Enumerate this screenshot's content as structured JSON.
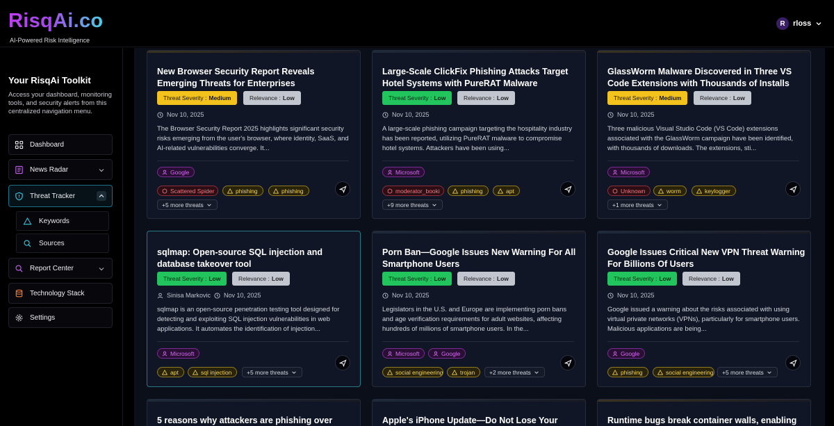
{
  "app": {
    "logo": "RisqAi.co",
    "tagline": "AI-Powered Risk Intelligence",
    "user": {
      "initial": "R",
      "name": "rloss"
    }
  },
  "sidebar": {
    "title": "Your RisqAi Toolkit",
    "description": "Access your dashboard, monitoring tools, and security alerts from this centralized navigation menu.",
    "items": [
      {
        "label": "Dashboard",
        "icon": "grid-icon"
      },
      {
        "label": "News Radar",
        "icon": "newspaper-icon"
      },
      {
        "label": "Threat Tracker",
        "icon": "shield-icon"
      },
      {
        "label": "Report Center",
        "icon": "search-icon"
      },
      {
        "label": "Technology Stack",
        "icon": "database-icon"
      },
      {
        "label": "Settings",
        "icon": "gear-icon"
      }
    ],
    "subitems": [
      {
        "label": "Keywords",
        "icon": "triangle-icon"
      },
      {
        "label": "Sources",
        "icon": "search-icon"
      }
    ]
  },
  "cards": [
    {
      "title": "New Browser Security Report Reveals Emerging Threats for Enterprises",
      "severity_label": "Threat Severity :",
      "severity": "Medium",
      "relevance_label": "Relevance :",
      "relevance": "Low",
      "author": "",
      "date": "Nov 10, 2025",
      "summary": "The Browser Security Report 2025 highlights significant security risks emerging from the user's browser, where identity, SaaS, and AI-related vulnerabilities converge. It...",
      "companies": [
        "Google"
      ],
      "actors": [
        "Scattered Spider"
      ],
      "threats": [
        "phishing",
        "phishing"
      ],
      "more": "+5 more threats"
    },
    {
      "title": "Large-Scale ClickFix Phishing Attacks Target Hotel Systems with PureRAT Malware",
      "severity_label": "Threat Severity :",
      "severity": "Low",
      "relevance_label": "Relevance :",
      "relevance": "Low",
      "author": "",
      "date": "Nov 10, 2025",
      "summary": "A large-scale phishing campaign targeting the hospitality industry has been reported, utilizing PureRAT malware to compromise hotel systems. Attackers have been using...",
      "companies": [
        "Microsoft"
      ],
      "actors": [
        "moderator_booki"
      ],
      "threats": [
        "phishing",
        "apt"
      ],
      "more": "+9 more threats"
    },
    {
      "title": "GlassWorm Malware Discovered in Three VS Code Extensions with Thousands of Installs",
      "severity_label": "Threat Severity :",
      "severity": "Medium",
      "relevance_label": "Relevance :",
      "relevance": "Low",
      "author": "",
      "date": "Nov 10, 2025",
      "summary": "Three malicious Visual Studio Code (VS Code) extensions associated with the GlassWorm campaign have been identified, with thousands of downloads. The extensions, sti...",
      "companies": [
        "Microsoft"
      ],
      "actors": [
        "Unknown"
      ],
      "threats": [
        "worm",
        "keylogger"
      ],
      "more": "+1 more threats"
    },
    {
      "title": "sqlmap: Open-source SQL injection and database takeover tool",
      "severity_label": "Threat Severity :",
      "severity": "Low",
      "relevance_label": "Relevance :",
      "relevance": "Low",
      "author": "Sinisa Markovic",
      "date": "Nov 10, 2025",
      "summary": "sqlmap is an open-source penetration testing tool designed for detecting and exploiting SQL injection vulnerabilities in web applications. It automates the identification of injection...",
      "companies": [
        "Microsoft"
      ],
      "actors": [],
      "threats": [
        "apt",
        "sql injection"
      ],
      "more": "+5 more threats"
    },
    {
      "title": "Porn Ban—Google Issues New Warning For All Smartphone Users",
      "severity_label": "Threat Severity :",
      "severity": "Low",
      "relevance_label": "Relevance :",
      "relevance": "Low",
      "author": "",
      "date": "Nov 10, 2025",
      "summary": "Legislators in the U.S. and Europe are implementing porn bans and age verification requirements for adult websites, affecting hundreds of millions of smartphone users. In the...",
      "companies": [
        "Microsoft",
        "Google"
      ],
      "actors": [],
      "threats": [
        "social engineering",
        "trojan"
      ],
      "more": "+2 more threats"
    },
    {
      "title": "Google Issues Critical New VPN Threat Warning For Billions Of Users",
      "severity_label": "Threat Severity :",
      "severity": "Low",
      "relevance_label": "Relevance :",
      "relevance": "Low",
      "author": "",
      "date": "Nov 10, 2025",
      "summary": "Google issued a warning about the risks associated with using virtual private networks (VPNs), particularly for smartphone users. Malicious applications are being...",
      "companies": [
        "Google"
      ],
      "actors": [],
      "threats": [
        "phishing",
        "social engineering"
      ],
      "more": "+5 more threats"
    },
    {
      "title": "5 reasons why attackers are phishing over"
    },
    {
      "title": "Apple's iPhone Update—Do Not Lose Your"
    },
    {
      "title": "Runtime bugs break container walls, enabling"
    }
  ]
}
